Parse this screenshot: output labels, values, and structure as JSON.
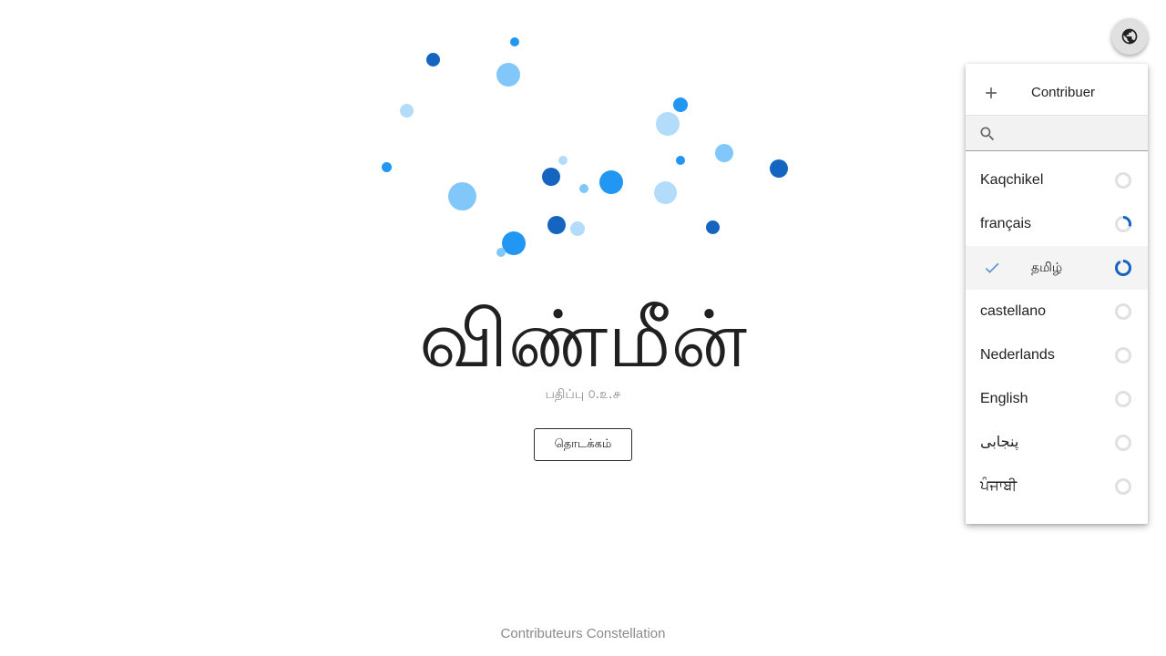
{
  "hero": {
    "title": "விண்மீன்",
    "version": "பதிப்பு ௦.௨.௪",
    "start_label": "தொடக்கம்"
  },
  "footer": {
    "text": "Contributeurs Constellation"
  },
  "language_menu": {
    "contribute_label": "Contribuer",
    "search_value": "",
    "items": [
      {
        "label": "Kaqchikel",
        "progress": 0,
        "selected": false
      },
      {
        "label": "français",
        "progress": 0.3,
        "selected": false
      },
      {
        "label": "தமிழ்",
        "progress": 0.92,
        "selected": true
      },
      {
        "label": "castellano",
        "progress": 0,
        "selected": false
      },
      {
        "label": "Nederlands",
        "progress": 0,
        "selected": false
      },
      {
        "label": "English",
        "progress": 0,
        "selected": false
      },
      {
        "label": "پنجابی",
        "progress": 0,
        "selected": false
      },
      {
        "label": "ਪੰਜਾਬੀ",
        "progress": 0,
        "selected": false
      }
    ]
  },
  "icons": {
    "language_button": "globe-icon",
    "contribute": "plus-icon",
    "search": "search-icon",
    "selected": "check-icon",
    "progress": "progress-ring-icon"
  },
  "colors": {
    "primary_dark": "#1565c0",
    "primary": "#2196f3",
    "primary_light": "#81c7fa",
    "primary_lighter": "#b3dcfb",
    "progress_track": "#e0e0e0"
  }
}
